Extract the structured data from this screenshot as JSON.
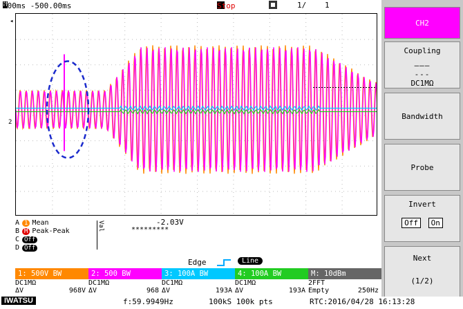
{
  "header": {
    "timebase": "100ms -500.00ms",
    "stop_label": "Stop",
    "page": "1/",
    "count": "1"
  },
  "panel": {
    "ch2": "CH2",
    "coupling": "Coupling",
    "coupling_value": "DC1MΩ",
    "bandwidth": "Bandwidth",
    "probe": "Probe",
    "invert": "Invert",
    "invert_off": "Off",
    "invert_on": "On",
    "next": "Next",
    "next_page": "(1/2)"
  },
  "measure": {
    "rows": [
      {
        "id": "A",
        "tag": "1",
        "label": "Mean"
      },
      {
        "id": "B",
        "tag": "M",
        "label": "Peak-Peak"
      },
      {
        "id": "C",
        "tag": "Off",
        "label": ""
      },
      {
        "id": "D",
        "tag": "Off",
        "label": ""
      }
    ],
    "val_label": "Val",
    "value1": "-2.03V",
    "value2": "*********"
  },
  "trigger": {
    "edge": "Edge",
    "line": "Line"
  },
  "channels": [
    {
      "name": "1:",
      "scale": "500V",
      "bw": "BW",
      "color": "#ff8800",
      "coupling": "DC1MΩ",
      "dv_label": "ΔV",
      "dv": "968V"
    },
    {
      "name": "2:",
      "scale": "500",
      "bw": "BW",
      "color": "#ff00ff",
      "coupling": "DC1MΩ",
      "dv_label": "ΔV",
      "dv": "968"
    },
    {
      "name": "3:",
      "scale": "100A",
      "bw": "BW",
      "color": "#00c8ff",
      "coupling": "DC1MΩ",
      "dv_label": "ΔV",
      "dv": "193A"
    },
    {
      "name": "4:",
      "scale": "100A",
      "bw": "BW",
      "color": "#22cc22",
      "coupling": "DC1MΩ",
      "dv_label": "ΔV",
      "dv": "193A"
    },
    {
      "name": "M:",
      "scale": "10dBm",
      "bw": "",
      "color": "#666666",
      "coupling": "2FFT",
      "dv_label": "Empty",
      "dv": "250Hz"
    }
  ],
  "footer": {
    "brand": "IWATSU",
    "freq": "f:59.9949Hz",
    "sample": "100kS 100k pts",
    "rtc": "RTC:2016/04/28 16:13:28"
  },
  "colors": {
    "ch1": "#ff8800",
    "ch2": "#ff00ff",
    "ch3": "#00c8ff",
    "ch4": "#22cc22",
    "marker": "#1a2acc"
  }
}
